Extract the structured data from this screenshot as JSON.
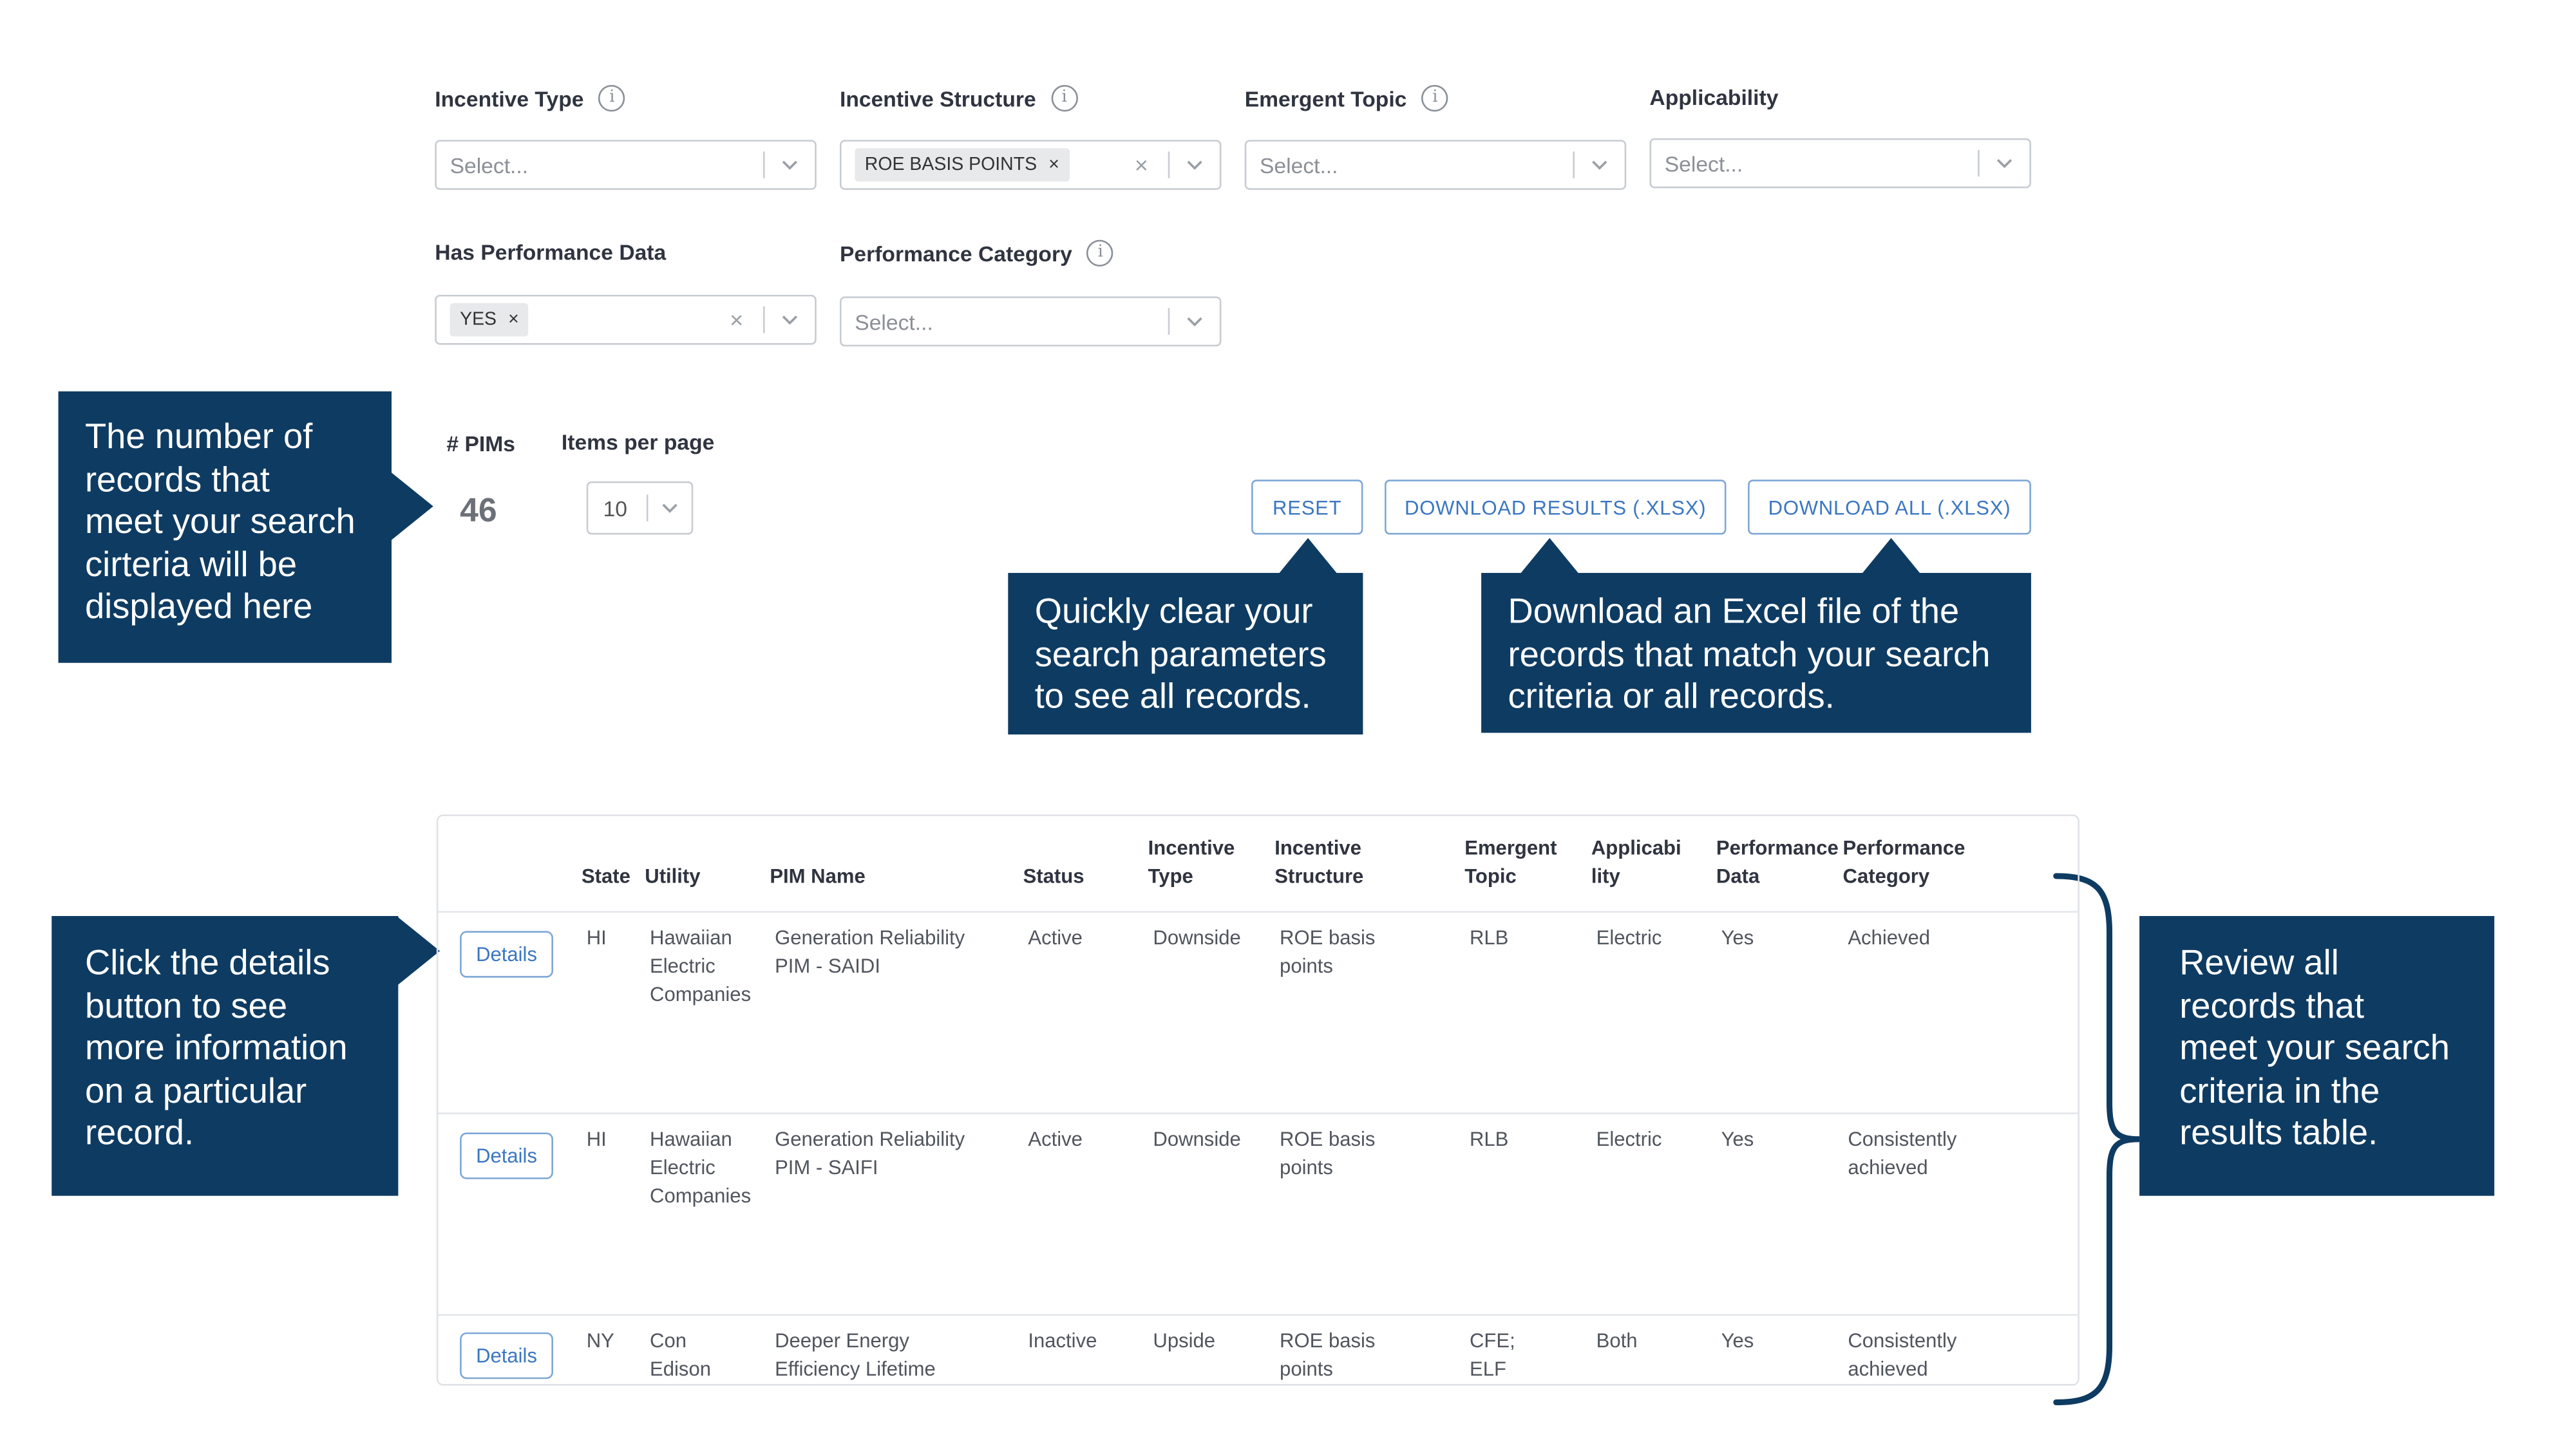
{
  "filters": {
    "incentive_type": {
      "label": "Incentive Type",
      "placeholder": "Select..."
    },
    "incentive_structure": {
      "label": "Incentive Structure",
      "tag": "ROE BASIS POINTS",
      "tag_remove": "×",
      "clear": "×"
    },
    "emergent_topic": {
      "label": "Emergent Topic",
      "placeholder": "Select..."
    },
    "applicability": {
      "label": "Applicability",
      "placeholder": "Select..."
    },
    "has_performance_data": {
      "label": "Has Performance Data",
      "tag": "YES",
      "tag_remove": "×",
      "clear": "×"
    },
    "performance_category": {
      "label": "Performance Category",
      "placeholder": "Select..."
    },
    "info_glyph": "i"
  },
  "results": {
    "count_label": "# PIMs",
    "count": "46",
    "items_per_page_label": "Items per page",
    "items_per_page": "10"
  },
  "actions": {
    "reset": "RESET",
    "download_results": "DOWNLOAD RESULTS (.XLSX)",
    "download_all": "DOWNLOAD ALL (.XLSX)"
  },
  "callouts": {
    "count": [
      "The number of",
      "records that",
      "meet your search",
      "cirteria will be",
      "displayed here"
    ],
    "reset": [
      "Quickly clear your",
      "search parameters",
      "to see all records."
    ],
    "download": [
      "Download an Excel file of the",
      "records that match your search",
      "criteria or all records."
    ],
    "details": [
      "Click the details",
      "button to see",
      "more information",
      "on a particular",
      "record."
    ],
    "table": [
      "Review all",
      "records that",
      "meet your search",
      "criteria in the",
      "results table."
    ]
  },
  "table": {
    "headers": {
      "state": "State",
      "utility": "Utility",
      "pim_name": "PIM Name",
      "status": "Status",
      "incentive_type": [
        "Incentive",
        "Type"
      ],
      "incentive_structure": [
        "Incentive",
        "Structure"
      ],
      "emergent_topic": [
        "Emergent",
        "Topic"
      ],
      "applicability": [
        "Applicabi",
        "lity"
      ],
      "performance_data": [
        "Performance",
        "Data"
      ],
      "performance_category": [
        "Performance",
        "Category"
      ]
    },
    "details_label": "Details",
    "rows": [
      {
        "state": "HI",
        "utility": [
          "Hawaiian",
          "Electric",
          "Companies"
        ],
        "pim_name": [
          "Generation Reliability",
          "PIM - SAIDI"
        ],
        "status": "Active",
        "incentive_type": "Downside",
        "incentive_structure": [
          "ROE basis",
          "points"
        ],
        "emergent_topic": [
          "RLB"
        ],
        "applicability": "Electric",
        "performance_data": "Yes",
        "performance_category": [
          "Achieved"
        ]
      },
      {
        "state": "HI",
        "utility": [
          "Hawaiian",
          "Electric",
          "Companies"
        ],
        "pim_name": [
          "Generation Reliability",
          "PIM - SAIFI"
        ],
        "status": "Active",
        "incentive_type": "Downside",
        "incentive_structure": [
          "ROE basis",
          "points"
        ],
        "emergent_topic": [
          "RLB"
        ],
        "applicability": "Electric",
        "performance_data": "Yes",
        "performance_category": [
          "Consistently",
          "achieved"
        ]
      },
      {
        "state": "NY",
        "utility": [
          "Con",
          "Edison"
        ],
        "pim_name": [
          "Deeper Energy",
          "Efficiency Lifetime"
        ],
        "status": "Inactive",
        "incentive_type": "Upside",
        "incentive_structure": [
          "ROE basis",
          "points"
        ],
        "emergent_topic": [
          "CFE;",
          "ELF"
        ],
        "applicability": "Both",
        "performance_data": "Yes",
        "performance_category": [
          "Consistently",
          "achieved"
        ]
      }
    ]
  },
  "colors": {
    "callout_bg": "#0e3b62",
    "button_blue": "#3b77c2",
    "border": "#c8ccd2"
  }
}
